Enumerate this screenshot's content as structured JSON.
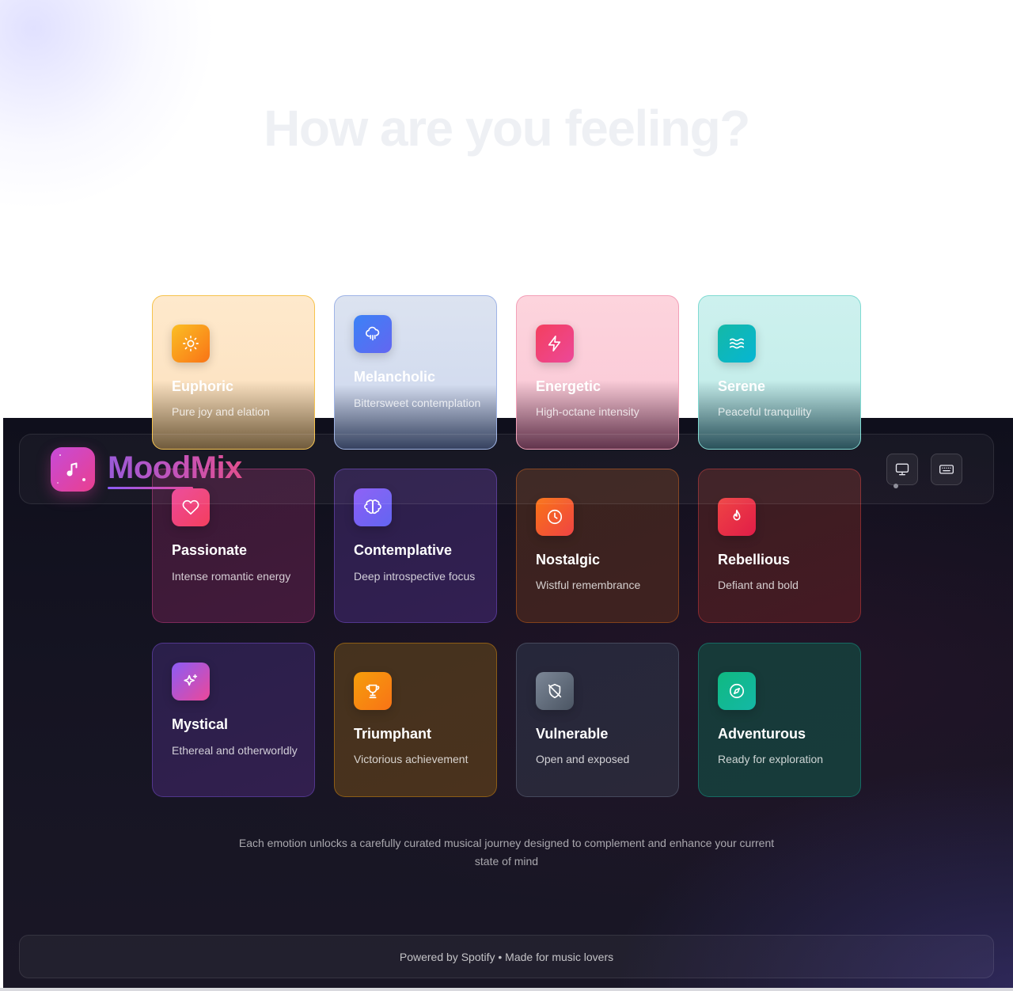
{
  "hero": {
    "title": "How are you feeling?"
  },
  "brand": {
    "name": "MoodMix",
    "logo_icon": "music-note-icon"
  },
  "nav": {
    "buttons": [
      {
        "icon": "monitor-icon"
      },
      {
        "icon": "keyboard-icon"
      }
    ]
  },
  "moods": [
    {
      "title": "Euphoric",
      "description": "Pure joy and elation",
      "icon": "sun-icon",
      "colors": [
        "#fbbf24",
        "#f97316"
      ]
    },
    {
      "title": "Melancholic",
      "description": "Bittersweet contemplation",
      "icon": "cloud-rain-icon",
      "colors": [
        "#3b82f6",
        "#6366f1"
      ]
    },
    {
      "title": "Energetic",
      "description": "High-octane intensity",
      "icon": "lightning-icon",
      "colors": [
        "#f43f5e",
        "#ec4899"
      ]
    },
    {
      "title": "Serene",
      "description": "Peaceful tranquility",
      "icon": "waves-icon",
      "colors": [
        "#14b8a6",
        "#06b6d4"
      ]
    },
    {
      "title": "Passionate",
      "description": "Intense romantic energy",
      "icon": "heart-icon",
      "colors": [
        "#ec4899",
        "#f43f5e"
      ]
    },
    {
      "title": "Contemplative",
      "description": "Deep introspective focus",
      "icon": "brain-icon",
      "colors": [
        "#8b5cf6",
        "#6366f1"
      ]
    },
    {
      "title": "Nostalgic",
      "description": "Wistful remembrance",
      "icon": "clock-icon",
      "colors": [
        "#f97316",
        "#ef4444"
      ]
    },
    {
      "title": "Rebellious",
      "description": "Defiant and bold",
      "icon": "flame-icon",
      "colors": [
        "#ef4444",
        "#e11d48"
      ]
    },
    {
      "title": "Mystical",
      "description": "Ethereal and otherworldly",
      "icon": "sparkles-icon",
      "colors": [
        "#8b5cf6",
        "#ec4899"
      ]
    },
    {
      "title": "Triumphant",
      "description": "Victorious achievement",
      "icon": "trophy-icon",
      "colors": [
        "#f59e0b",
        "#f97316"
      ]
    },
    {
      "title": "Vulnerable",
      "description": "Open and exposed",
      "icon": "shield-off-icon",
      "colors": [
        "#64748b",
        "#475569"
      ]
    },
    {
      "title": "Adventurous",
      "description": "Ready for exploration",
      "icon": "compass-icon",
      "colors": [
        "#10b981",
        "#14b8a6"
      ]
    }
  ],
  "footer": {
    "tagline": "Each emotion unlocks a carefully curated musical journey designed to complement and enhance your current state of mind",
    "credit": "Powered by Spotify • Made for music lovers"
  }
}
